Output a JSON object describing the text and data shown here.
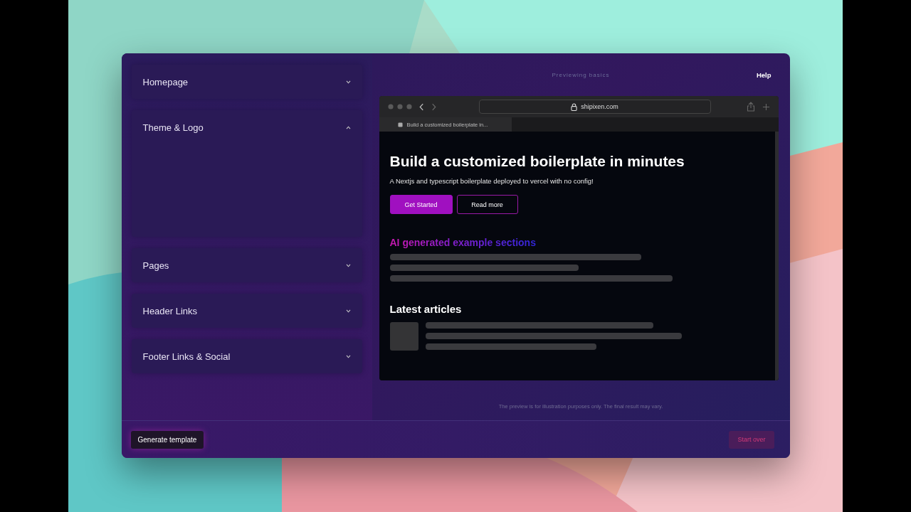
{
  "sections": [
    {
      "label": "Homepage",
      "expanded": false
    },
    {
      "label": "Theme & Logo",
      "expanded": true
    },
    {
      "label": "Pages",
      "expanded": false
    },
    {
      "label": "Header Links",
      "expanded": false
    },
    {
      "label": "Footer Links & Social",
      "expanded": false
    }
  ],
  "preview": {
    "caption": "Previewing basics",
    "help": "Help",
    "url": "shipixen.com",
    "tab": "Build a customized boilerplate in...",
    "title": "Build a customized boilerplate in minutes",
    "subtitle": "A Nextjs and typescript boilerplate deployed to vercel with no config!",
    "buttons": [
      {
        "label": "Get Started",
        "kind": "primary"
      },
      {
        "label": "Read more",
        "kind": "outline"
      }
    ],
    "sections_heading": "AI generated example sections",
    "articles_heading": "Latest articles",
    "note": "The preview is for illustration purposes only. The final result may vary."
  },
  "footer": {
    "generate": "Generate template",
    "start_over": "Start over"
  }
}
